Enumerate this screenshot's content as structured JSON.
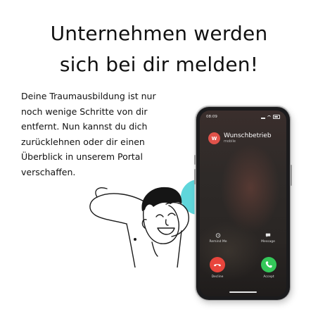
{
  "heading": {
    "line1": "Unternehmen werden",
    "line2": "sich bei dir melden!"
  },
  "body_text": "Deine Traumausbildung ist nur noch wenige Schritte von dir entfernt. Nun kannst du dich zurücklehnen oder dir einen Überblick in unserem Portal verschaffen.",
  "phone": {
    "status_time": "08:09",
    "caller": {
      "avatar_letter": "W",
      "name": "Wunschbetrieb",
      "sub": "mobile"
    },
    "remind_label": "Remind Me",
    "message_label": "Message",
    "decline_label": "Decline",
    "accept_label": "Accept",
    "colors": {
      "decline": "#e8453c",
      "accept": "#34c759",
      "avatar": "#e0524a"
    }
  },
  "decor": {
    "accent_color": "#5fd6db",
    "icons": [
      "alarm-icon",
      "message-bubble-icon",
      "phone-decline-icon",
      "phone-accept-icon"
    ]
  }
}
